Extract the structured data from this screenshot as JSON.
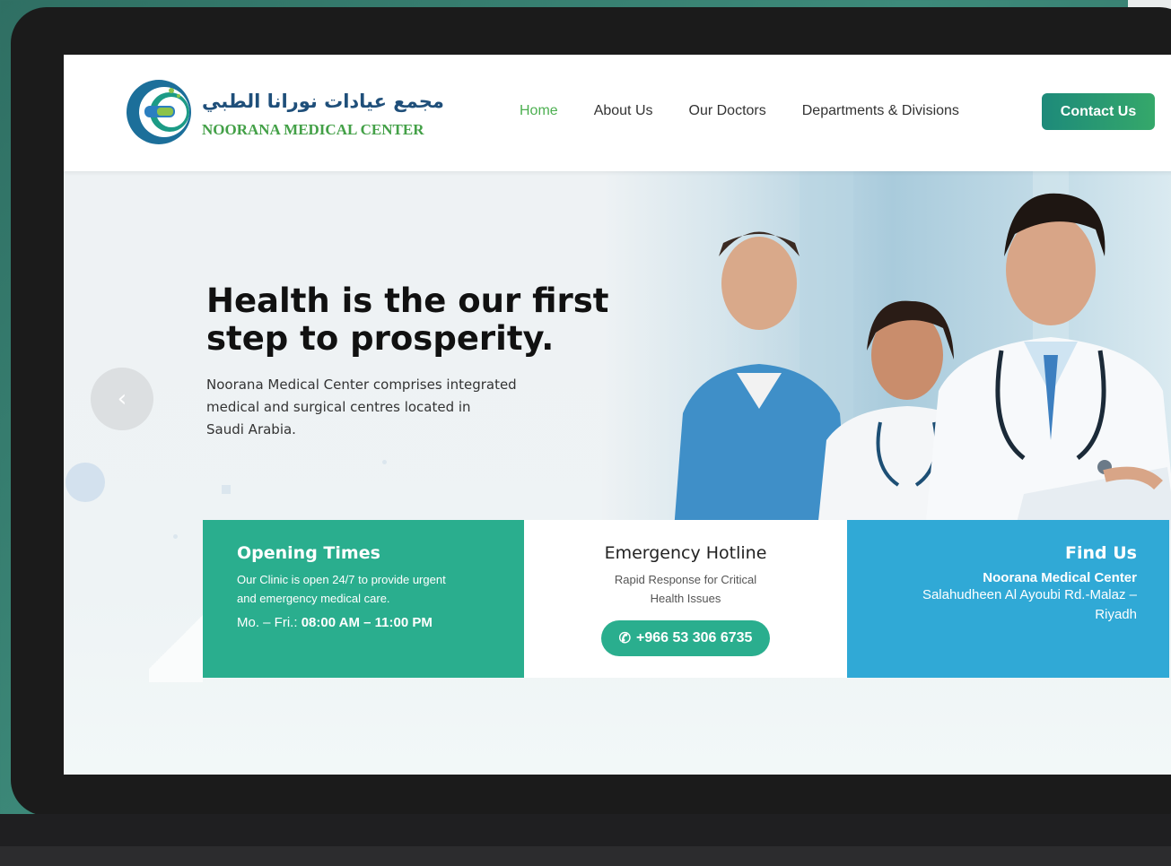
{
  "brand": {
    "name_ar": "مجمع عيادات نورانا الطبي",
    "name_en": "NOORANA MEDICAL CENTER",
    "badge_text": "NOORANA",
    "colors": {
      "primary_green": "#4caf50",
      "teal": "#2aae8e",
      "blue": "#30a9d6",
      "navy": "#1f4f7a"
    }
  },
  "nav": {
    "items": [
      {
        "label": "Home",
        "active": true
      },
      {
        "label": "About Us",
        "active": false
      },
      {
        "label": "Our Doctors",
        "active": false
      },
      {
        "label": "Departments & Divisions",
        "active": false
      }
    ],
    "cta_label": "Contact Us"
  },
  "hero": {
    "title_line1": "Health is the our first",
    "title_line2": "step to prosperity.",
    "text_line1": "Noorana Medical Center comprises integrated",
    "text_line2": "medical and surgical centres located in",
    "text_line3": "Saudi Arabia.",
    "prev_icon": "‹"
  },
  "cards": {
    "opening": {
      "title": "Opening Times",
      "line1": "Our Clinic is open 24/7 to provide urgent",
      "line2": "and emergency medical care.",
      "days": "Mo. – Fri.:",
      "hours": "08:00 AM – 11:00 PM"
    },
    "emergency": {
      "title": "Emergency Hotline",
      "line1": "Rapid Response for Critical",
      "line2": "Health Issues",
      "phone_icon": "✆",
      "phone": "+966 53 306 6735"
    },
    "find": {
      "title": "Find Us",
      "name": "Noorana Medical Center",
      "addr_line1": "Salahudheen Al Ayoubi Rd.-Malaz –",
      "addr_line2": "Riyadh"
    }
  }
}
